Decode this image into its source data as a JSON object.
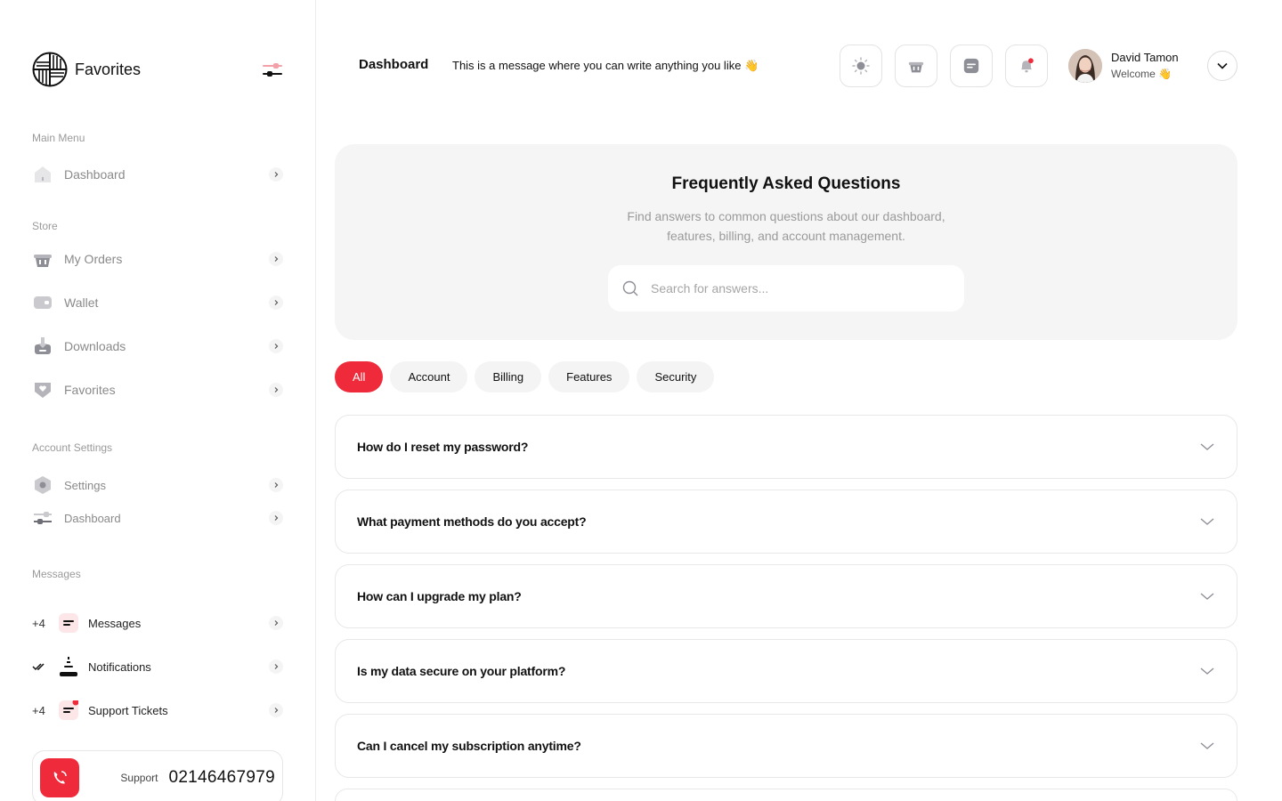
{
  "brand": {
    "name": "Favorites"
  },
  "sidebar": {
    "sections": {
      "main_menu": "Main Menu",
      "store": "Store",
      "account_settings": "Account Settings",
      "messages": "Messages"
    },
    "main_items": [
      {
        "label": "Dashboard",
        "icon": "home-icon"
      }
    ],
    "store_items": [
      {
        "label": "My Orders",
        "icon": "basket-icon"
      },
      {
        "label": "Wallet",
        "icon": "wallet-icon"
      },
      {
        "label": "Downloads",
        "icon": "download-icon"
      },
      {
        "label": "Favorites",
        "icon": "heart-shield-icon"
      }
    ],
    "settings_items": [
      {
        "label": "Settings",
        "icon": "hexagon-gear-icon"
      },
      {
        "label": "Dashboard",
        "icon": "sliders-icon"
      }
    ],
    "message_items": [
      {
        "count": "+4",
        "label": "Messages",
        "icon": "message-lines-icon"
      },
      {
        "count": "",
        "label": "Notifications",
        "icon": "bell-icon"
      },
      {
        "count": "+4",
        "label": "Support Tickets",
        "icon": "ticket-lines-icon"
      }
    ],
    "support": {
      "label": "Support",
      "phone": "02146467979"
    }
  },
  "header": {
    "title": "Dashboard",
    "message": "This is a message where you can write anything you like 👋",
    "user": {
      "name": "David Tamon",
      "welcome": "Welcome 👋"
    }
  },
  "faq": {
    "title": "Frequently Asked Questions",
    "subtitle_line1": "Find answers to common questions about our dashboard,",
    "subtitle_line2": "features, billing, and account management.",
    "search_placeholder": "Search for answers...",
    "tabs": [
      "All",
      "Account",
      "Billing",
      "Features",
      "Security"
    ],
    "active_tab": "All",
    "questions": [
      "How do I reset my password?",
      "What payment methods do you accept?",
      "How can I upgrade my plan?",
      "Is my data secure on your platform?",
      "Can I cancel my subscription anytime?"
    ]
  },
  "colors": {
    "accent": "#ef2b3b",
    "muted_text": "#9a9a9a",
    "panel_bg": "#f5f5f6"
  }
}
